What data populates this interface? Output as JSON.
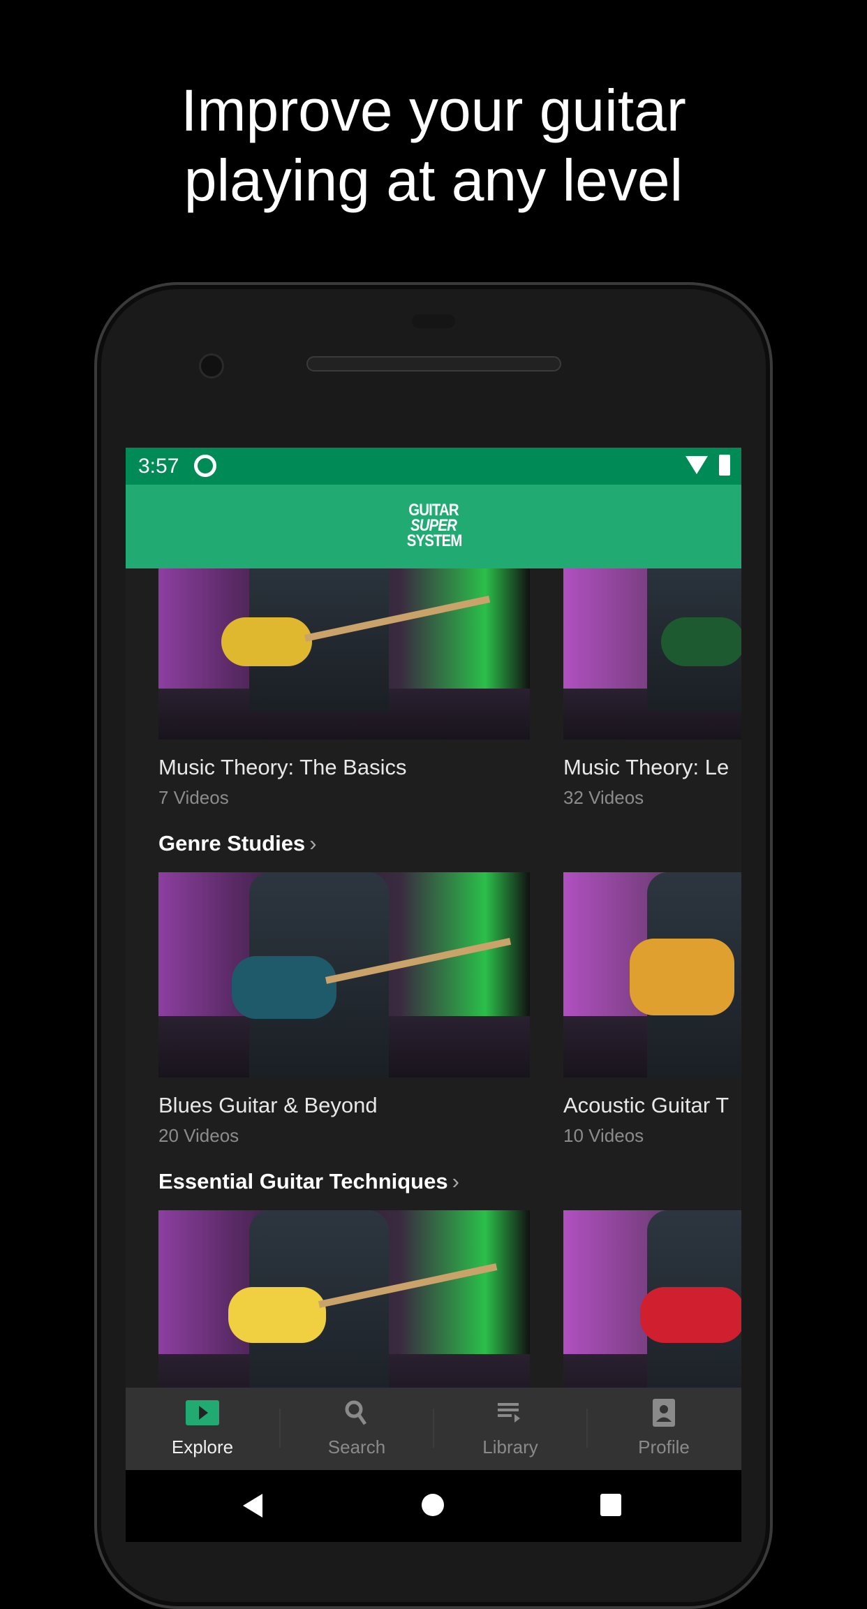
{
  "headline": {
    "line1": "Improve your guitar",
    "line2": "playing at any level"
  },
  "status_bar": {
    "time": "3:57",
    "icons": [
      "do-not-disturb-icon",
      "wifi-icon",
      "battery-charging-icon"
    ],
    "color": "#008a55"
  },
  "app_bar": {
    "logo_text": [
      "GUITAR",
      "SUPER",
      "SYSTEM"
    ],
    "color": "#22aa73"
  },
  "rows": [
    {
      "section_title": "",
      "cards": [
        {
          "title": "Music Theory: The Basics",
          "subtitle": "7 Videos"
        },
        {
          "title": "Music Theory: Le",
          "subtitle": "32 Videos"
        }
      ]
    },
    {
      "section_title": "Genre Studies",
      "cards": [
        {
          "title": "Blues Guitar & Beyond",
          "subtitle": "20 Videos"
        },
        {
          "title": "Acoustic Guitar T",
          "subtitle": "10 Videos"
        }
      ]
    },
    {
      "section_title": "Essential Guitar Techniques",
      "cards": [
        {
          "title": "",
          "subtitle": ""
        },
        {
          "title": "",
          "subtitle": ""
        }
      ]
    }
  ],
  "chevron": "›",
  "bottom_nav": {
    "items": [
      {
        "label": "Explore",
        "icon": "play-box-icon",
        "active": true
      },
      {
        "label": "Search",
        "icon": "search-icon",
        "active": false
      },
      {
        "label": "Library",
        "icon": "playlist-icon",
        "active": false
      },
      {
        "label": "Profile",
        "icon": "account-box-icon",
        "active": false
      }
    ],
    "active_color": "#22aa73"
  }
}
